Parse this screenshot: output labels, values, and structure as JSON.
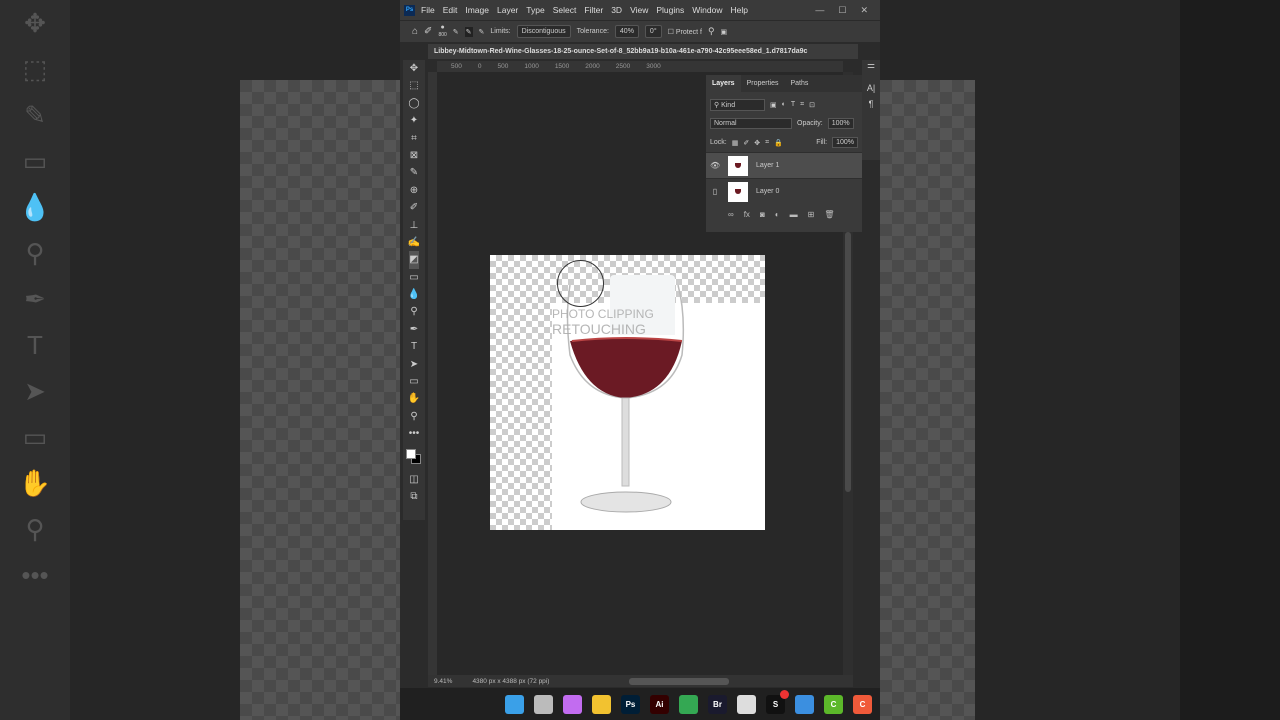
{
  "menu": {
    "app_icon": "Ps",
    "items": [
      "File",
      "Edit",
      "Image",
      "Layer",
      "Type",
      "Select",
      "Filter",
      "3D",
      "View",
      "Plugins",
      "Window",
      "Help"
    ]
  },
  "options": {
    "brush_size": "800",
    "limits_label": "Limits:",
    "limits_value": "Discontiguous",
    "tolerance_label": "Tolerance:",
    "tolerance_value": "40%",
    "angle_value": "0°",
    "protect_label": "Protect f"
  },
  "document": {
    "tab_title": "Libbey-Midtown-Red-Wine-Glasses-18-25-ounce-Set-of-8_52bb9a19-b10a-461e-a790-42c95eee58ed_1.d7817da9c",
    "ruler_ticks": [
      "500",
      "0",
      "500",
      "1000",
      "1500",
      "2000",
      "2500",
      "3000"
    ],
    "watermark": [
      "PHOTO CLIPPING",
      "RETOUCHING"
    ]
  },
  "layers_panel": {
    "tabs": [
      "Layers",
      "Properties",
      "Paths"
    ],
    "filter": "Kind",
    "blend_mode": "Normal",
    "opacity_label": "Opacity:",
    "opacity": "100%",
    "lock_label": "Lock:",
    "fill_label": "Fill:",
    "fill": "100%",
    "layers": [
      {
        "name": "Layer 1",
        "visible": true,
        "selected": true
      },
      {
        "name": "Layer 0",
        "visible": false,
        "selected": false
      }
    ]
  },
  "status": {
    "zoom": "9.41%",
    "doc_info": "4380 px x 4388 px (72 ppi)"
  },
  "taskbar": {
    "apps": [
      {
        "name": "start",
        "label": "",
        "color": "#3aa0e8"
      },
      {
        "name": "task-view",
        "label": "",
        "color": "#bbbbbb"
      },
      {
        "name": "copilot",
        "label": "",
        "color": "#c26cf0"
      },
      {
        "name": "file-explorer",
        "label": "",
        "color": "#f2c230"
      },
      {
        "name": "photoshop",
        "label": "Ps",
        "color": "#001e36"
      },
      {
        "name": "illustrator",
        "label": "Ai",
        "color": "#330000"
      },
      {
        "name": "chrome",
        "label": "",
        "color": "#34a853"
      },
      {
        "name": "bridge",
        "label": "Br",
        "color": "#1a1a2e"
      },
      {
        "name": "snipping",
        "label": "",
        "color": "#dddddd"
      },
      {
        "name": "s-app",
        "label": "S",
        "color": "#111111",
        "badge": "1"
      },
      {
        "name": "photos",
        "label": "",
        "color": "#3b8fe0"
      },
      {
        "name": "camtasia",
        "label": "C",
        "color": "#5cb82a"
      },
      {
        "name": "camtasia-red",
        "label": "C",
        "color": "#f05a3a"
      }
    ]
  }
}
